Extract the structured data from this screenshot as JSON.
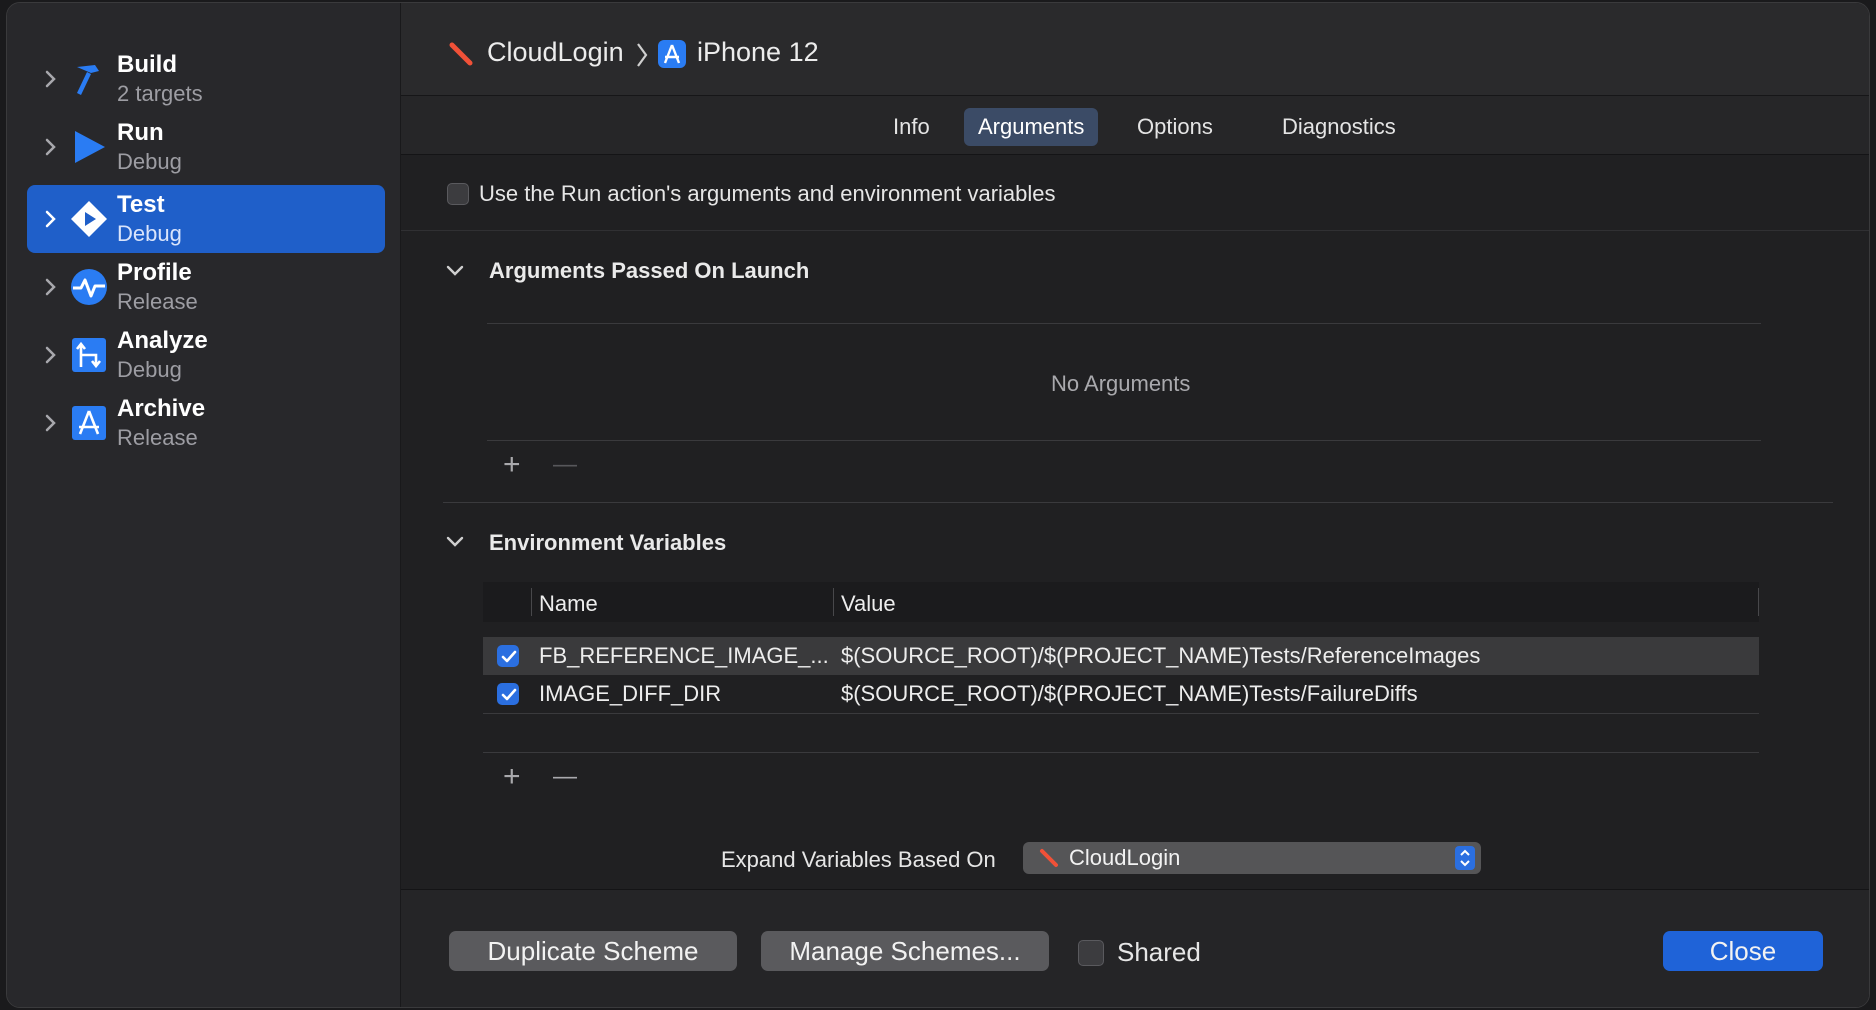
{
  "sidebar": {
    "items": [
      {
        "title": "Build",
        "subtitle": "2 targets"
      },
      {
        "title": "Run",
        "subtitle": "Debug"
      },
      {
        "title": "Test",
        "subtitle": "Debug"
      },
      {
        "title": "Profile",
        "subtitle": "Release"
      },
      {
        "title": "Analyze",
        "subtitle": "Debug"
      },
      {
        "title": "Archive",
        "subtitle": "Release"
      }
    ],
    "selected_index": 2
  },
  "header": {
    "scheme": "CloudLogin",
    "destination": "iPhone 12"
  },
  "tabs": {
    "items": [
      "Info",
      "Arguments",
      "Options",
      "Diagnostics"
    ],
    "active": "Arguments"
  },
  "use_run_args": {
    "label": "Use the Run action's arguments and environment variables",
    "checked": false
  },
  "arguments_section": {
    "title": "Arguments Passed On Launch",
    "empty_text": "No Arguments",
    "add": "+",
    "remove": "—"
  },
  "env_section": {
    "title": "Environment Variables",
    "columns": [
      "Name",
      "Value"
    ],
    "rows": [
      {
        "checked": true,
        "name": "FB_REFERENCE_IMAGE_...",
        "value": "$(SOURCE_ROOT)/$(PROJECT_NAME)Tests/ReferenceImages"
      },
      {
        "checked": true,
        "name": "IMAGE_DIFF_DIR",
        "value": "$(SOURCE_ROOT)/$(PROJECT_NAME)Tests/FailureDiffs"
      }
    ],
    "add": "+",
    "remove": "—"
  },
  "expand": {
    "label": "Expand Variables Based On",
    "value": "CloudLogin"
  },
  "footer": {
    "duplicate": "Duplicate Scheme",
    "manage": "Manage Schemes...",
    "shared_label": "Shared",
    "shared_checked": false,
    "close": "Close"
  },
  "colors": {
    "accent": "#1f63d8",
    "icon_blue": "#2a7cf3",
    "swift_orange": "#f05138"
  }
}
